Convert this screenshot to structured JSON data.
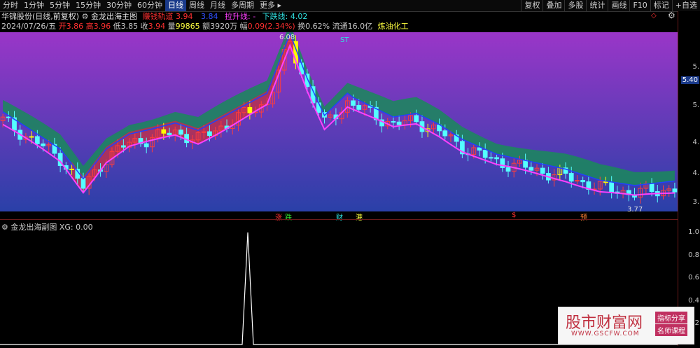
{
  "toolbar": {
    "items": [
      "分时",
      "1分钟",
      "5分钟",
      "15分钟",
      "30分钟",
      "60分钟",
      "日线",
      "周线",
      "月线",
      "多周期",
      "更多"
    ],
    "active": "日线",
    "right_items": [
      "复权",
      "叠加",
      "多股",
      "统计",
      "画线",
      "F10",
      "标记",
      "+自选"
    ]
  },
  "info_row1": {
    "stock_name": "华锦股份(日线,前复权)",
    "indicator": "金龙出海主图",
    "field1_label": "赚钱轨道",
    "field1_value": "3.94",
    "field2_value": "3.84",
    "field3_label": "拉升线:",
    "field3_value": "-",
    "field4_label": "下跌线:",
    "field4_value": "4.02"
  },
  "info_row2": {
    "date": "2024/07/26/五",
    "open_label": "开",
    "open": "3.86",
    "high_label": "高",
    "high": "3.96",
    "low_label": "低",
    "low": "3.85",
    "close_label": "收",
    "close": "3.94",
    "vol_label": "量",
    "vol": "99865",
    "amount_label": "额",
    "amount": "3920万",
    "change_label": "幅",
    "change": "0.09(2.34%)",
    "turnover_label": "换",
    "turnover": "0.62%",
    "float_label": "流通",
    "float_cap": "16.0亿",
    "sector": "炼油化工"
  },
  "chart_labels": {
    "high_mark": "6.08",
    "low_mark": "3.77",
    "st_mark": "ST"
  },
  "event_marks": [
    "涨",
    "跌",
    "财",
    "港",
    "$",
    "预"
  ],
  "axis_ticks": [
    "5.",
    "5.40",
    "5.",
    "4.",
    "4.",
    "3.",
    "1.0",
    "0.8",
    "0.6",
    "0.4",
    "0.2"
  ],
  "sub_header": {
    "title": "金龙出海副图",
    "xg_label": "XG:",
    "xg_value": "0.00"
  },
  "watermark": {
    "title": "股市财富网",
    "tag1": "指标分享",
    "tag2": "名师课程",
    "url": "WWW.GSCFW.COM"
  },
  "colors": {
    "up": "#ff3c3c",
    "down": "#54ffff",
    "ma_pink": "#ff40ff",
    "band_green": "#1a8a5a",
    "band_red": "#b83050",
    "yellow": "#ffff00",
    "blue_line": "#2040ff"
  }
}
